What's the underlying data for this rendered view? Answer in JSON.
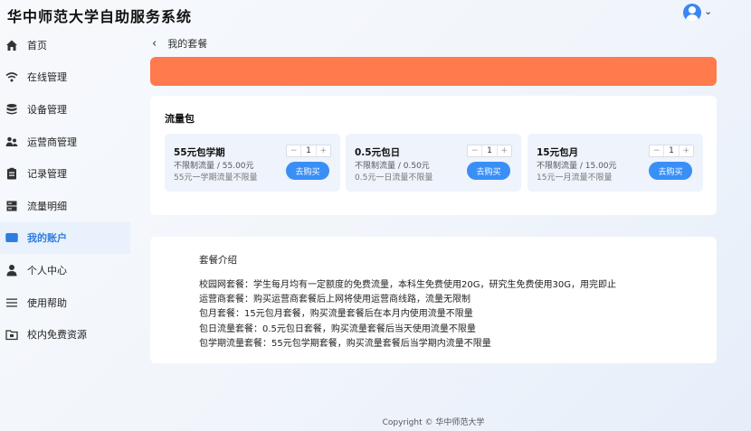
{
  "app": {
    "title": "华中师范大学自助服务系统"
  },
  "sidebar": {
    "items": [
      {
        "label": "首页",
        "icon": "home-icon"
      },
      {
        "label": "在线管理",
        "icon": "wifi-icon"
      },
      {
        "label": "设备管理",
        "icon": "database-icon"
      },
      {
        "label": "运营商管理",
        "icon": "users-icon"
      },
      {
        "label": "记录管理",
        "icon": "clipboard-icon"
      },
      {
        "label": "流量明细",
        "icon": "server-icon"
      },
      {
        "label": "我的账户",
        "icon": "card-icon",
        "active": true
      },
      {
        "label": "个人中心",
        "icon": "user-icon"
      },
      {
        "label": "使用帮助",
        "icon": "menu-icon"
      },
      {
        "label": "校内免费资源",
        "icon": "folder-icon"
      }
    ]
  },
  "page": {
    "breadcrumb": "我的套餐"
  },
  "packs": {
    "section_title": "流量包",
    "buy_label": "去购买",
    "items": [
      {
        "name": "55元包学期",
        "price": "不限制流量 / 55.00元",
        "desc": "55元一学期流量不限量",
        "qty": "1"
      },
      {
        "name": "0.5元包日",
        "price": "不限制流量 / 0.50元",
        "desc": "0.5元一日流量不限量",
        "qty": "1"
      },
      {
        "name": "15元包月",
        "price": "不限制流量 / 15.00元",
        "desc": "15元一月流量不限量",
        "qty": "1"
      }
    ]
  },
  "intro": {
    "title": "套餐介绍",
    "lines": [
      "校园网套餐：学生每月均有一定额度的免费流量，本科生免费使用20G，研究生免费使用30G，用完即止",
      "运营商套餐：购买运营商套餐后上网将使用运营商线路，流量无限制",
      "包月套餐：15元包月套餐，购买流量套餐后在本月内使用流量不限量",
      "包日流量套餐：0.5元包日套餐，购买流量套餐后当天使用流量不限量",
      "包学期流量套餐：55元包学期套餐，购买流量套餐后当学期内流量不限量"
    ]
  },
  "footer": {
    "text": "Copyright © 华中师范大学"
  },
  "colors": {
    "accent": "#3a8ff7",
    "banner": "#ff7a4c",
    "active_bg": "#e9f1fc"
  }
}
